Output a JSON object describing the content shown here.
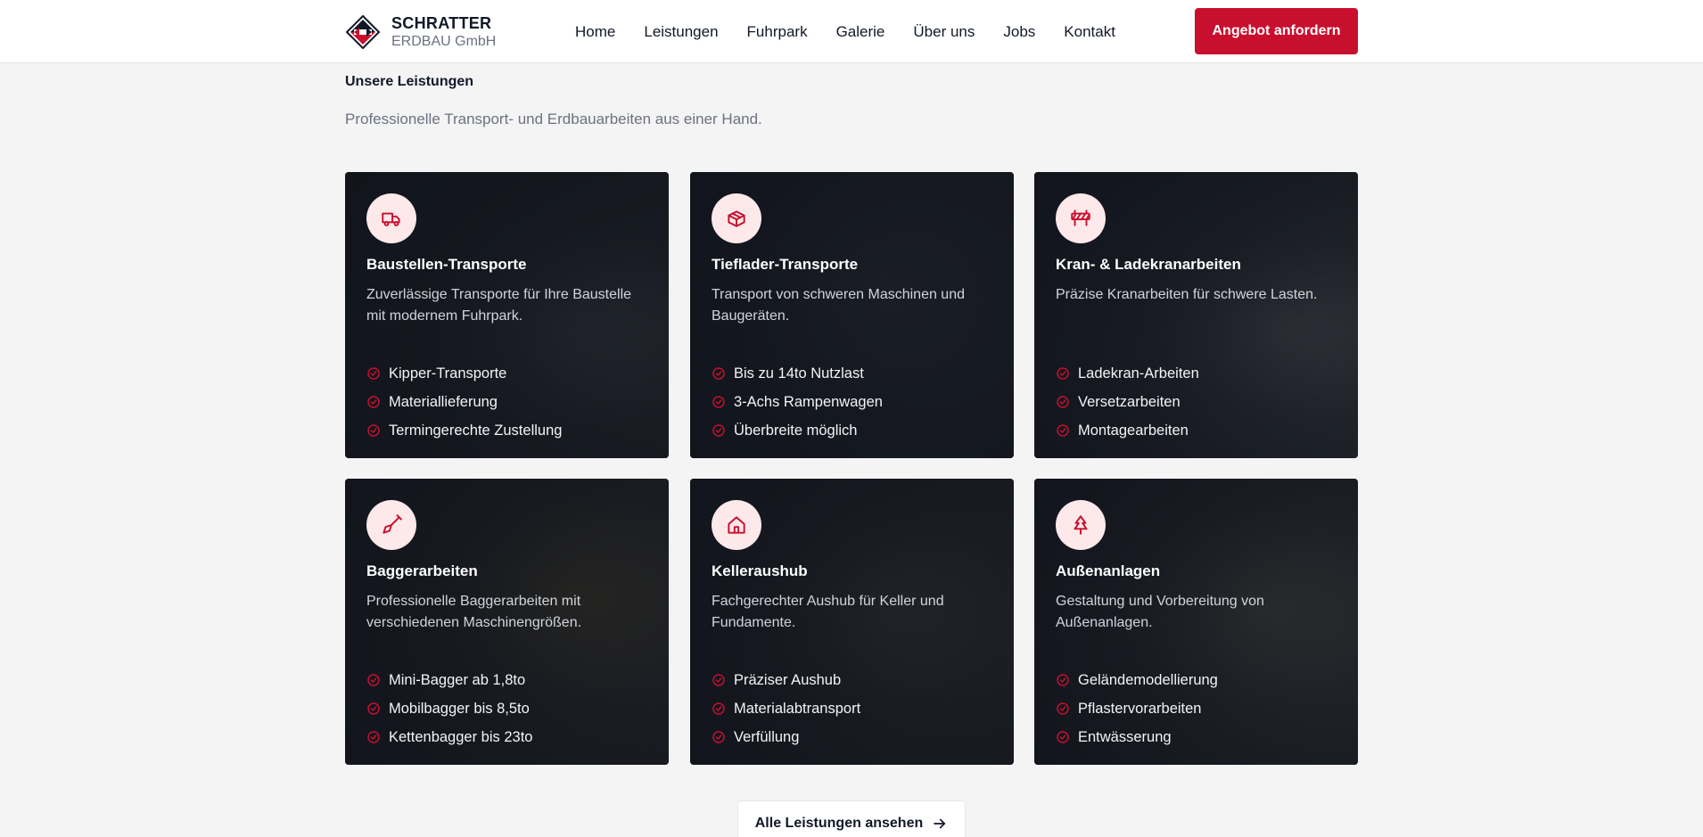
{
  "brand": {
    "name": "SCHRATTER",
    "subtitle": "ERDBAU GmbH"
  },
  "nav": [
    "Home",
    "Leistungen",
    "Fuhrpark",
    "Galerie",
    "Über uns",
    "Jobs",
    "Kontakt"
  ],
  "cta_label": "Angebot anfordern",
  "section": {
    "title": "Unsere Leistungen",
    "subtitle": "Professionelle Transport- und Erdbauarbeiten aus einer Hand."
  },
  "colors": {
    "accent": "#c8102e",
    "icon_bg": "#fde8ea",
    "card_dark": "#11141c"
  },
  "cards": [
    {
      "icon": "truck-icon",
      "title": "Baustellen-Transporte",
      "description": "Zuverlässige Transporte für Ihre Baustelle mit modernem Fuhrpark.",
      "items": [
        "Kipper-Transporte",
        "Materiallieferung",
        "Termingerechte Zustellung"
      ]
    },
    {
      "icon": "container-icon",
      "title": "Tieflader-Transporte",
      "description": "Transport von schweren Maschinen und Baugeräten.",
      "items": [
        "Bis zu 14to Nutzlast",
        "3-Achs Rampenwagen",
        "Überbreite möglich"
      ]
    },
    {
      "icon": "construction-barrier-icon",
      "title": "Kran- & Ladekranarbeiten",
      "description": "Präzise Kranarbeiten für schwere Lasten.",
      "items": [
        "Ladekran-Arbeiten",
        "Versetzarbeiten",
        "Montagearbeiten"
      ]
    },
    {
      "icon": "shovel-icon",
      "title": "Baggerarbeiten",
      "description": "Professionelle Baggerarbeiten mit verschiedenen Maschinengrößen.",
      "items": [
        "Mini-Bagger ab 1,8to",
        "Mobilbagger bis 8,5to",
        "Kettenbagger bis 23to"
      ]
    },
    {
      "icon": "house-icon",
      "title": "Kelleraushub",
      "description": "Fachgerechter Aushub für Keller und Fundamente.",
      "items": [
        "Präziser Aushub",
        "Materialabtransport",
        "Verfüllung"
      ]
    },
    {
      "icon": "tree-icon",
      "title": "Außenanlagen",
      "description": "Gestaltung und Vorbereitung von Außenanlagen.",
      "items": [
        "Geländemodellierung",
        "Pflastervorarbeiten",
        "Entwässerung"
      ]
    }
  ],
  "all_services_label": "Alle Leistungen ansehen"
}
